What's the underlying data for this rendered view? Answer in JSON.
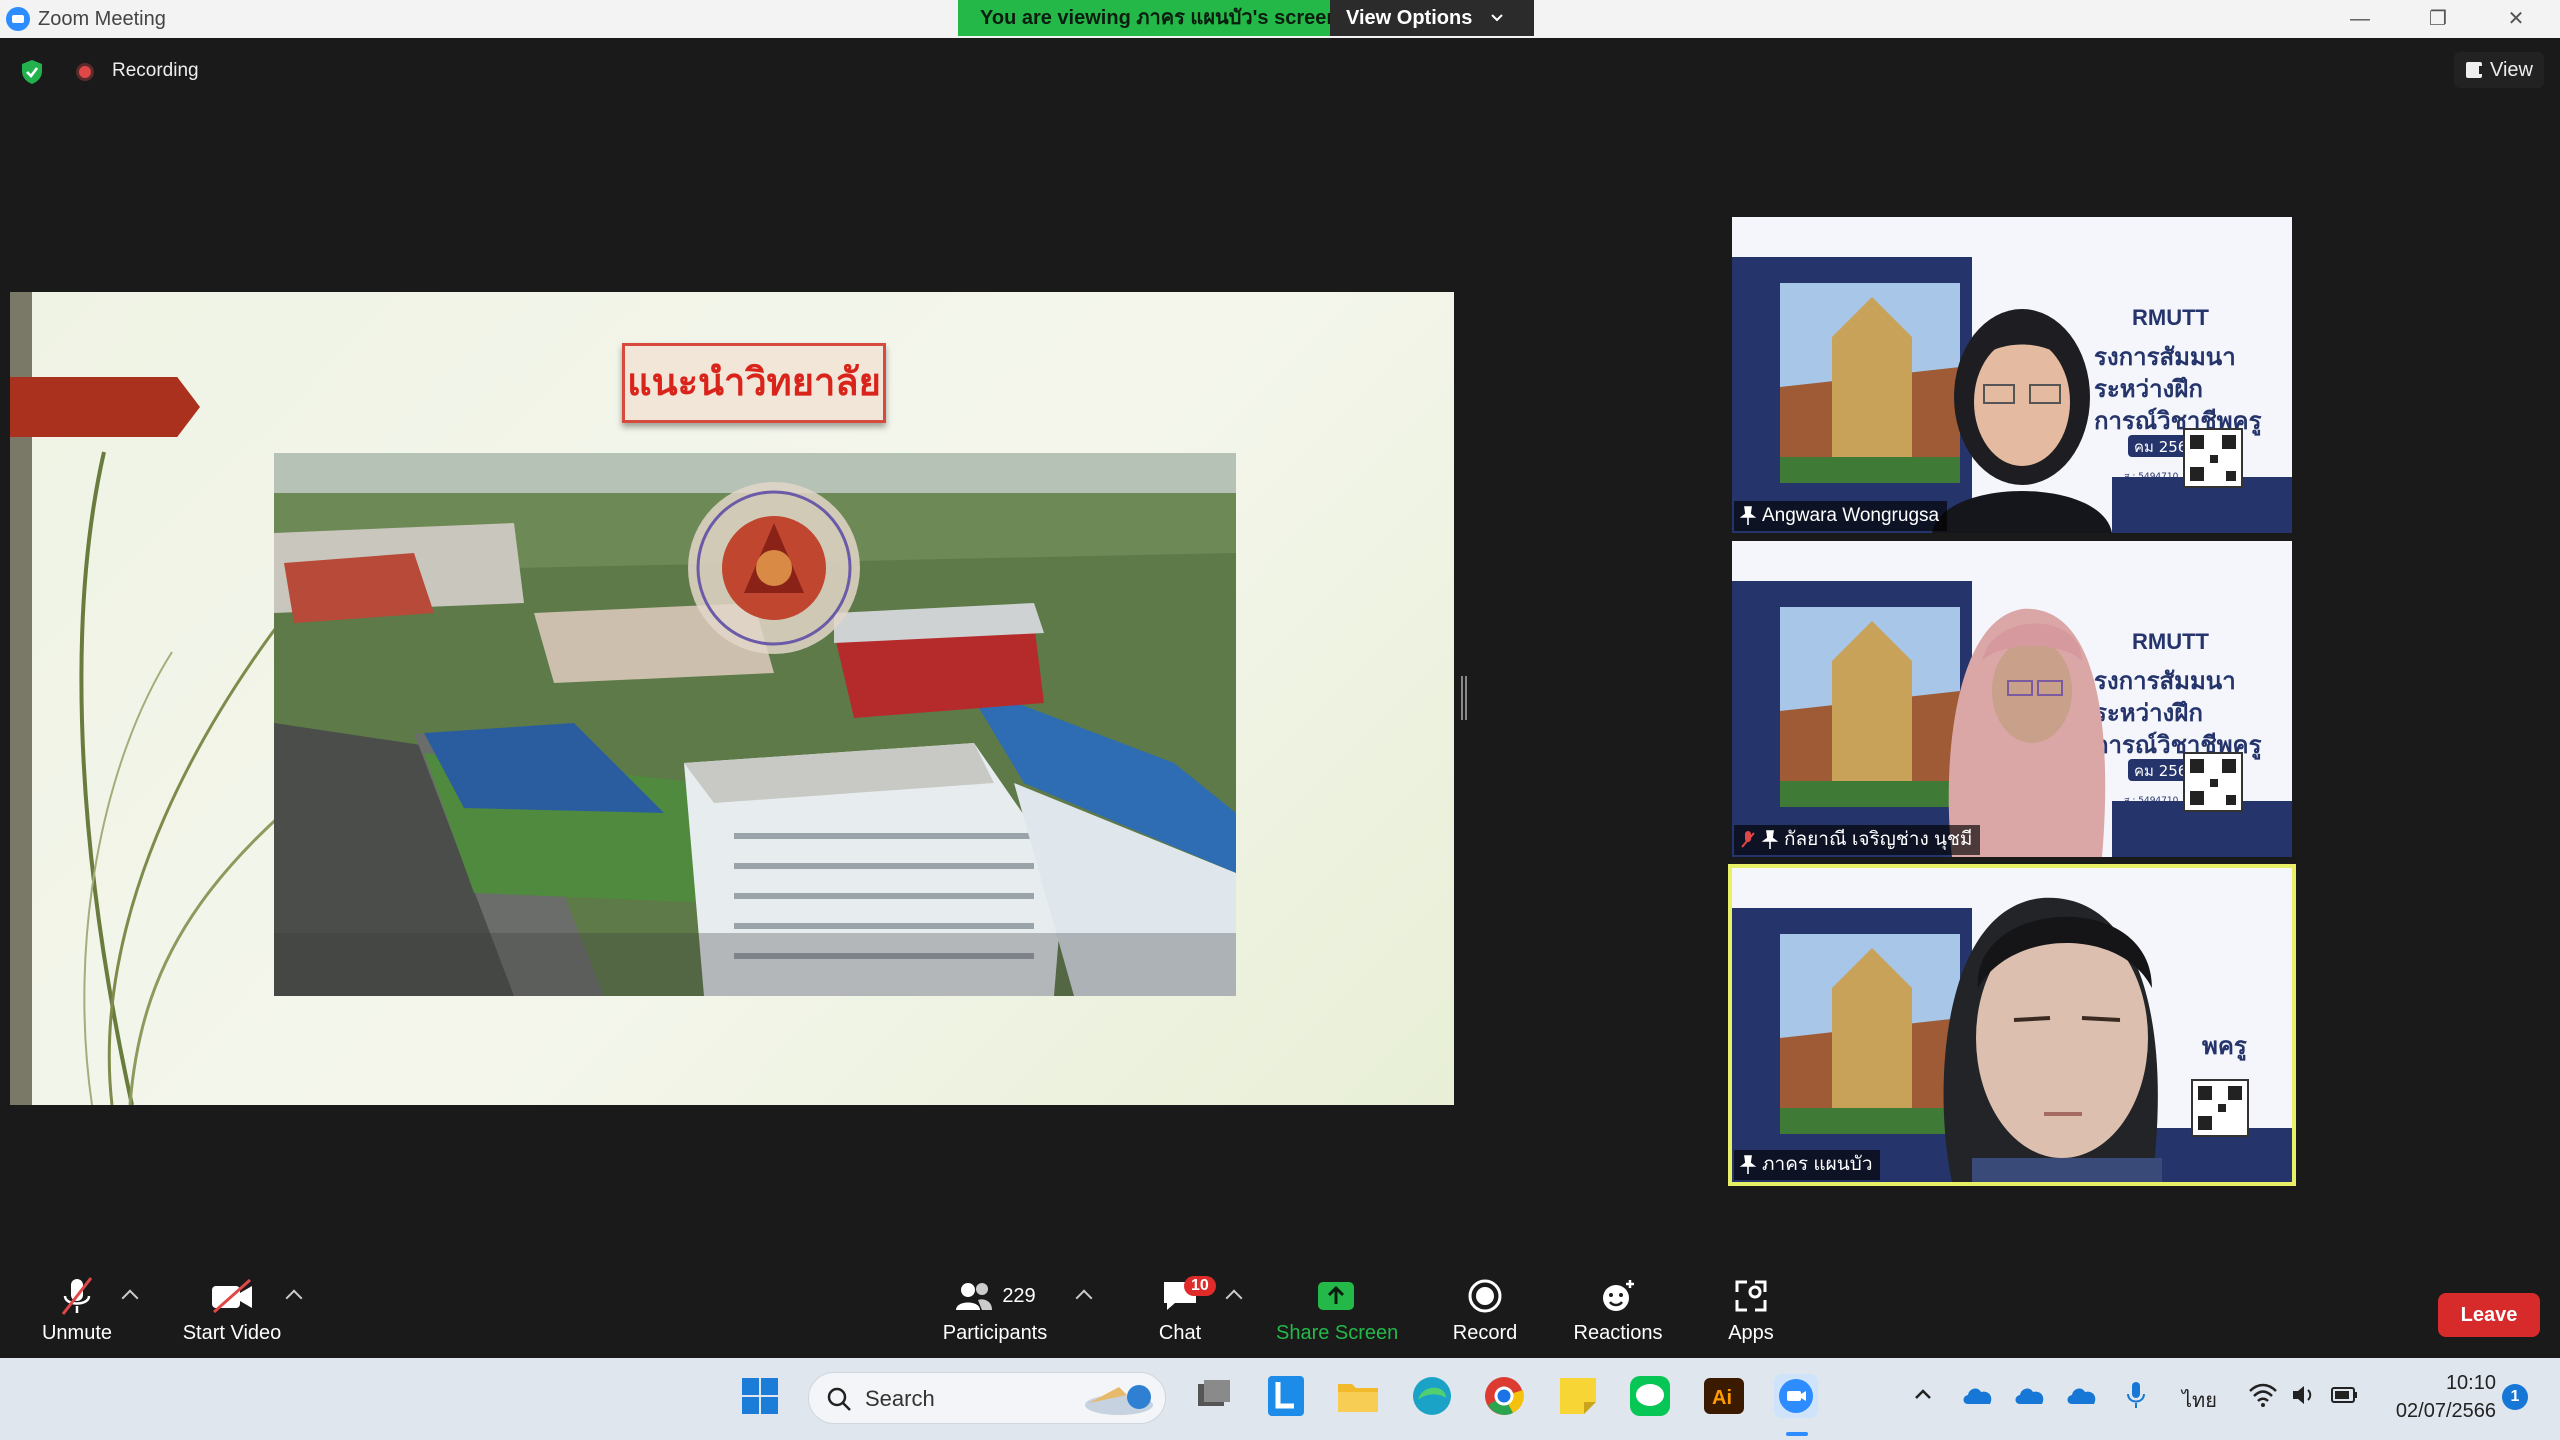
{
  "window": {
    "title": "Zoom Meeting",
    "viewing_message": "You are viewing ภาคร แผนบัว's screen",
    "view_options_label": "View Options",
    "minimize": "—",
    "restore": "❐",
    "close": "✕"
  },
  "meeting_bar": {
    "recording_label": "Recording",
    "view_label": "View"
  },
  "slide": {
    "heading": "แนะนำวิทยาลัย"
  },
  "participants": [
    {
      "name": "Angwara Wongrugsa"
    },
    {
      "name": "กัลยาณี เจริญช่าง นุชมี"
    },
    {
      "name": "ภาคร แผนบัว"
    }
  ],
  "tile_text": {
    "logo": "RMUTT",
    "line1": "รงการสัมมนา",
    "line2": "ระหว่างฝึก",
    "line3": "การณ์วิชาชีพครู",
    "line3_short": "พครู",
    "date": "คม 2566",
    "code": "ส : 5494710"
  },
  "toolbar": {
    "unmute": "Unmute",
    "start_video": "Start Video",
    "participants_label": "Participants",
    "participants_count": "229",
    "chat_label": "Chat",
    "chat_badge": "10",
    "share_screen": "Share Screen",
    "record": "Record",
    "reactions": "Reactions",
    "apps": "Apps",
    "leave": "Leave"
  },
  "taskbar": {
    "search_label": "Search",
    "language": "ไทย",
    "time": "10:10",
    "date": "02/07/2566",
    "notification_count": "1"
  },
  "colors": {
    "share_green": "#24b848",
    "leave_red": "#d72b2b",
    "active_speaker_border": "#e8f066",
    "slide_title_red": "#d9241c"
  }
}
